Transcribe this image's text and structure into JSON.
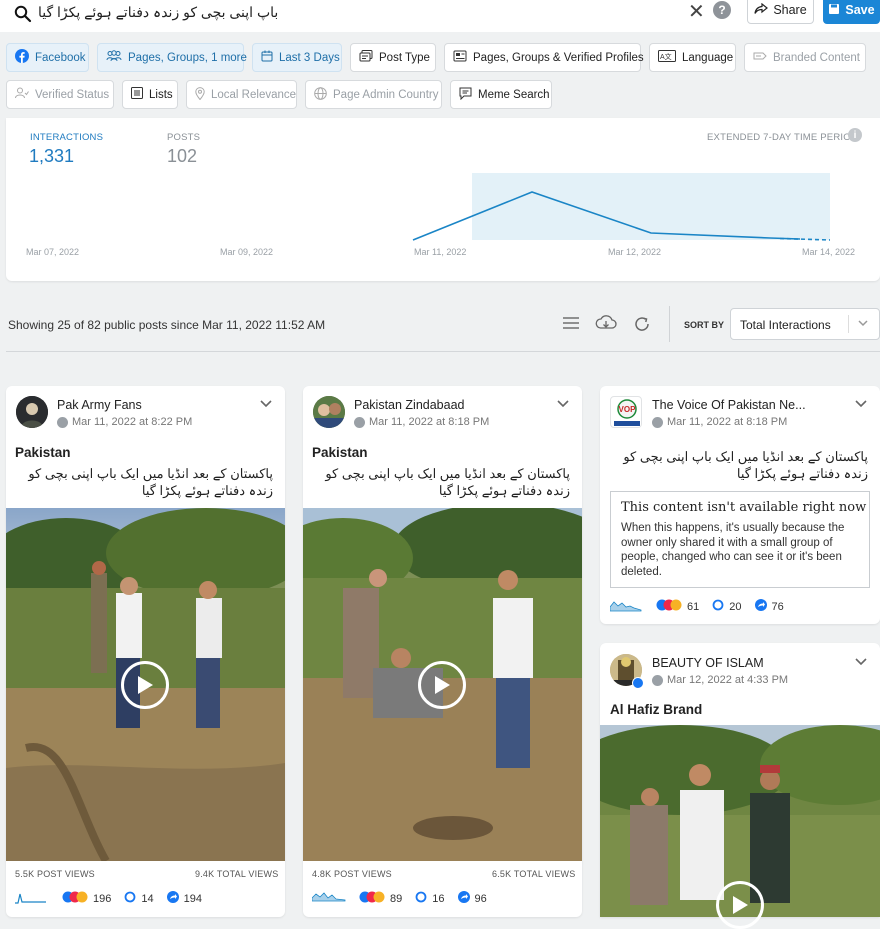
{
  "search": {
    "query": "باپ اپنی بچی کو زندہ دفناتے ہوئے پکڑا گیا",
    "share_label": "Share",
    "save_label": "Save"
  },
  "filters": {
    "row1": [
      "Facebook",
      "Pages, Groups, 1 more",
      "Last 3 Days",
      "Post Type",
      "Pages, Groups & Verified Profiles",
      "Language",
      "Branded Content"
    ],
    "row2": [
      "Verified Status",
      "Lists",
      "Local Relevance",
      "Page Admin Country",
      "Meme Search"
    ]
  },
  "summary": {
    "interactions_label": "INTERACTIONS",
    "interactions_value": "1,331",
    "posts_label": "POSTS",
    "posts_value": "102",
    "period_label": "EXTENDED 7-DAY TIME PERIOD"
  },
  "chart_data": {
    "type": "line",
    "x": [
      "Mar 07, 2022",
      "Mar 09, 2022",
      "Mar 11, 2022",
      "Mar 12, 2022",
      "Mar 14, 2022"
    ],
    "series": [
      {
        "values": [
          null,
          null,
          0,
          250,
          40,
          10,
          0
        ]
      }
    ],
    "highlight": [
      "Mar 11, 2022",
      "Mar 14, 2022"
    ]
  },
  "results": {
    "showing_text": "Showing 25 of 82 public posts since Mar 11, 2022 11:52 AM",
    "sort_label": "SORT BY",
    "sort_value": "Total Interactions"
  },
  "posts": [
    {
      "name": "Pak Army Fans",
      "date": "Mar 11, 2022 at 8:22 PM",
      "title": "Pakistan",
      "text": "پاکستان کے بعد انڈیا میں ایک باپ اپنی بچی کو زندہ دفناتے ہوئے پکڑا گیا",
      "post_views": "5.5K POST VIEWS",
      "total_views": "9.4K TOTAL VIEWS",
      "reactions": "196",
      "comments": "14",
      "shares": "194"
    },
    {
      "name": "Pakistan Zindabaad",
      "date": "Mar 11, 2022 at 8:18 PM",
      "title": "Pakistan",
      "text": "پاکستان کے بعد انڈیا میں ایک باپ اپنی بچی کو زندہ دفناتے ہوئے پکڑا گیا",
      "post_views": "4.8K POST VIEWS",
      "total_views": "6.5K TOTAL VIEWS",
      "reactions": "89",
      "comments": "16",
      "shares": "96"
    },
    {
      "name": "The Voice Of Pakistan Ne...",
      "date": "Mar 11, 2022 at 8:18 PM",
      "text": "پاکستان کے بعد انڈیا میں ایک باپ اپنی بچی کو زندہ دفناتے ہوئے پکڑا گیا",
      "unavailable_title": "This content isn't available right now",
      "unavailable_body": "When this happens, it's usually because the owner only shared it with a small group of people, changed who can see it or it's been deleted.",
      "reactions": "61",
      "comments": "20",
      "shares": "76",
      "logo_text": "VOP"
    },
    {
      "name": "BEAUTY OF ISLAM",
      "date": "Mar 12, 2022 at 4:33 PM",
      "title": "Al Hafiz Brand"
    }
  ],
  "colors": {
    "accent": "#1f7bc0",
    "line": "#1a85c6",
    "highlight": "#e3f1f8",
    "save_bg": "#1b86d6"
  }
}
